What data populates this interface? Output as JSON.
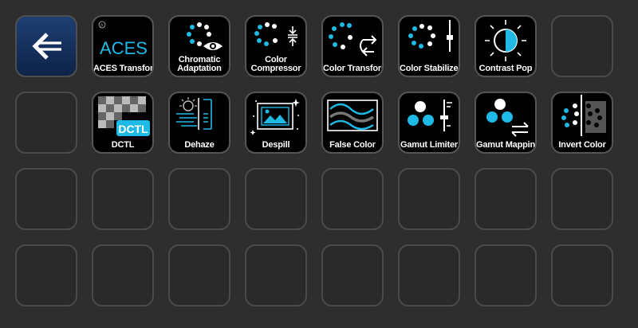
{
  "colors": {
    "accent": "#1fb9e6",
    "key_bg": "#000000",
    "empty_key_bg": "#2a2a2a",
    "back_key": "#153563",
    "background": "#2e2e2e"
  },
  "keys": [
    {
      "type": "back",
      "icon": "back-arrow-icon"
    },
    {
      "label": "ACES Transform",
      "icon": "aces-logo-icon",
      "logo_text": "ACES"
    },
    {
      "label_lines": [
        "Chromatic",
        "Adaptation"
      ],
      "icon": "eye-dots-icon"
    },
    {
      "label_lines": [
        "Color",
        "Compressor"
      ],
      "icon": "compress-dots-icon"
    },
    {
      "label": "Color Transform",
      "icon": "transform-dots-icon"
    },
    {
      "label": "Color Stabilizer",
      "icon": "slider-dots-icon"
    },
    {
      "label": "Contrast Pop",
      "icon": "contrast-sun-icon"
    },
    {
      "type": "empty"
    },
    {
      "type": "empty"
    },
    {
      "label": "DCTL",
      "icon": "checkerboard-icon",
      "badge": "DCTL"
    },
    {
      "label": "Dehaze",
      "icon": "dehaze-icon"
    },
    {
      "label": "Despill",
      "icon": "image-sparkle-icon"
    },
    {
      "label": "False Color",
      "icon": "wave-lines-icon"
    },
    {
      "label": "Gamut Limiter",
      "icon": "gamut-limit-icon"
    },
    {
      "label": "Gamut Mapping",
      "icon": "gamut-map-icon"
    },
    {
      "label": "Invert Color",
      "icon": "invert-dots-icon"
    }
  ]
}
